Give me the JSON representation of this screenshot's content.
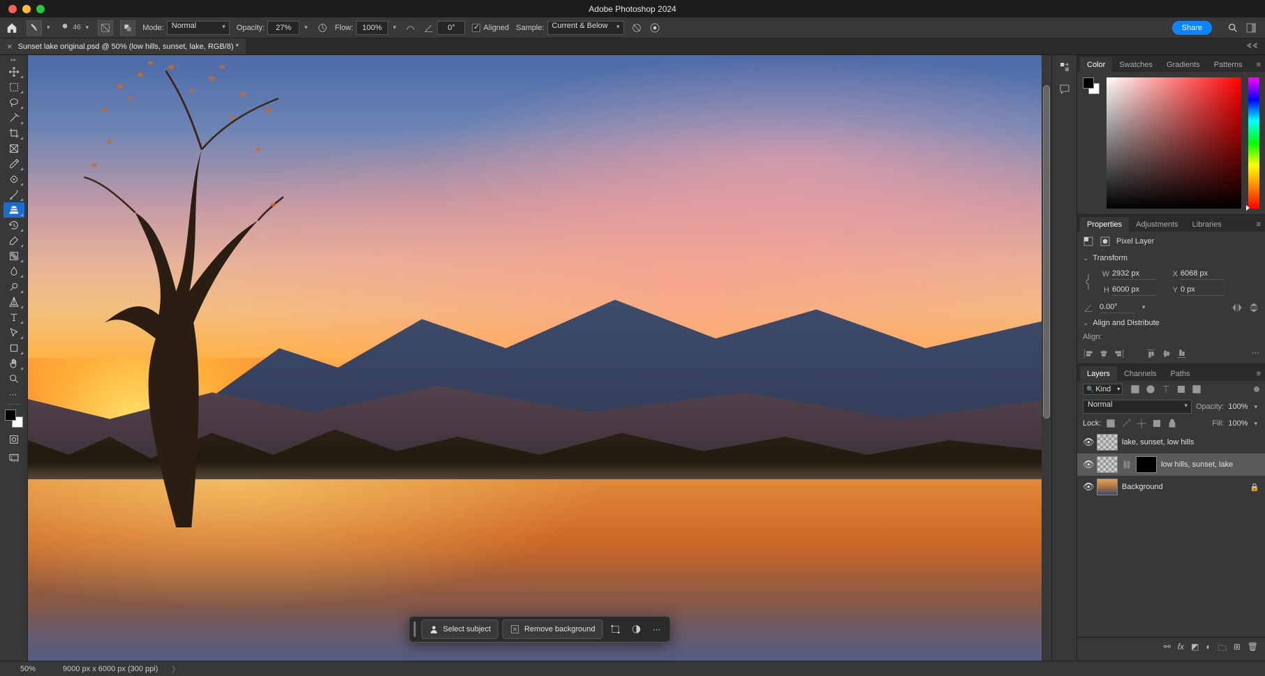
{
  "app_title": "Adobe Photoshop 2024",
  "document_tab": "Sunset lake original.psd @ 50% (low hills, sunset, lake, RGB/8) *",
  "options_bar": {
    "brush_size": "46",
    "mode_label": "Mode:",
    "mode_value": "Normal",
    "opacity_label": "Opacity:",
    "opacity_value": "27%",
    "flow_label": "Flow:",
    "flow_value": "100%",
    "angle_value": "0°",
    "aligned_label": "Aligned",
    "sample_label": "Sample:",
    "sample_value": "Current & Below",
    "share_label": "Share"
  },
  "contextual_bar": {
    "select_subject": "Select subject",
    "remove_bg": "Remove background"
  },
  "panels": {
    "color_tabs": [
      "Color",
      "Swatches",
      "Gradients",
      "Patterns"
    ],
    "properties_tabs": [
      "Properties",
      "Adjustments",
      "Libraries"
    ],
    "pixel_layer_label": "Pixel Layer",
    "transform_title": "Transform",
    "transform": {
      "W": "2932 px",
      "H": "6000 px",
      "X": "6068 px",
      "Y": "0 px",
      "angle": "0.00°"
    },
    "align_title": "Align and Distribute",
    "align_label": "Align:",
    "layers_tabs": [
      "Layers",
      "Channels",
      "Paths"
    ],
    "kind_label": "Kind",
    "blend_mode": "Normal",
    "layer_opacity_label": "Opacity:",
    "layer_opacity_value": "100%",
    "lock_label": "Lock:",
    "fill_label": "Fill:",
    "fill_value": "100%",
    "layers": [
      {
        "name": "lake, sunset, low hills",
        "selected": false,
        "mask": false,
        "checker": true
      },
      {
        "name": "low hills, sunset, lake",
        "selected": true,
        "mask": true,
        "checker": true
      },
      {
        "name": "Background",
        "selected": false,
        "mask": false,
        "checker": false,
        "locked": true
      }
    ]
  },
  "status": {
    "zoom": "50%",
    "dims": "9000 px x 6000 px (300 ppi)"
  }
}
